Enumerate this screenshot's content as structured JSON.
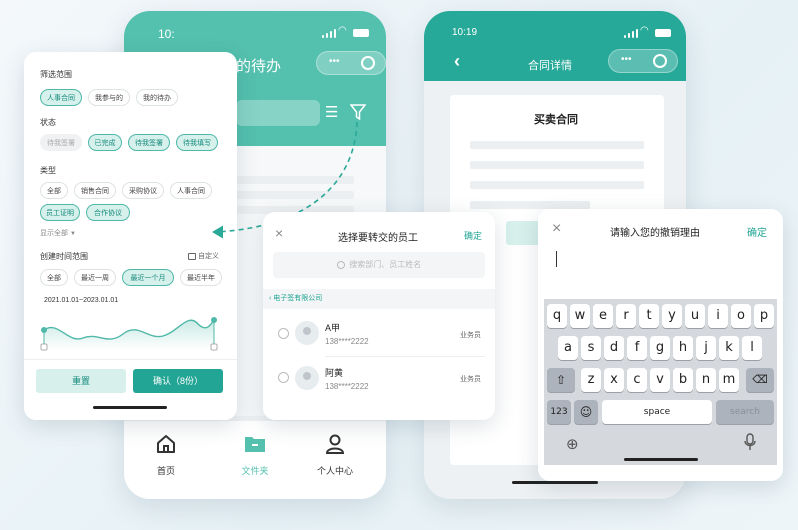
{
  "phone1": {
    "time": "10:",
    "title": "的待办",
    "nav": [
      {
        "label": "首页",
        "icon": "home-icon"
      },
      {
        "label": "文件夹",
        "icon": "folder-icon"
      },
      {
        "label": "个人中心",
        "icon": "person-icon"
      }
    ],
    "accent": "#54c0ae"
  },
  "phone2": {
    "time": "10:19",
    "title": "合同详情",
    "doc_title": "买卖合同",
    "header_color": "#26a998"
  },
  "filter": {
    "scope_label": "筛选范围",
    "scope_chips": [
      {
        "label": "人事合同",
        "selected": true
      },
      {
        "label": "我参与的",
        "selected": false
      },
      {
        "label": "我的待办",
        "selected": false
      }
    ],
    "status_label": "状态",
    "status_chips": [
      {
        "label": "待我签署",
        "state": "disabled"
      },
      {
        "label": "已完成",
        "state": "selected"
      },
      {
        "label": "待我签署",
        "state": "selected"
      },
      {
        "label": "待我填写",
        "state": "selected"
      }
    ],
    "type_label": "类型",
    "type_chips": [
      {
        "label": "全部",
        "selected": false
      },
      {
        "label": "销售合同",
        "selected": false
      },
      {
        "label": "采购协议",
        "selected": false
      },
      {
        "label": "人事合同",
        "selected": false
      },
      {
        "label": "员工证明",
        "selected": true
      },
      {
        "label": "合作协议",
        "selected": true
      }
    ],
    "show_all": "显示全部",
    "date_label": "创建时间范围",
    "custom_label": "自定义",
    "date_chips": [
      {
        "label": "全部",
        "selected": false
      },
      {
        "label": "最近一周",
        "selected": false
      },
      {
        "label": "最近一个月",
        "selected": true
      },
      {
        "label": "最近半年",
        "selected": false
      }
    ],
    "date_range": "2021.01.01~2023.01.01",
    "reset_label": "重置",
    "confirm_label": "确认（8份）"
  },
  "transfer": {
    "title": "选择要转交的员工",
    "confirm": "确定",
    "search_placeholder": "搜索部门、员工姓名",
    "company": "电子签有限公司",
    "employees": [
      {
        "name": "A甲",
        "phone": "138****2222",
        "role": "业务员"
      },
      {
        "name": "阿黄",
        "phone": "138****2222",
        "role": "业务员"
      }
    ]
  },
  "revoke": {
    "title": "请输入您的撤销理由",
    "confirm": "确定",
    "keyboard": {
      "row1": [
        "q",
        "w",
        "e",
        "r",
        "t",
        "y",
        "u",
        "i",
        "o",
        "p"
      ],
      "row2": [
        "a",
        "s",
        "d",
        "f",
        "g",
        "h",
        "j",
        "k",
        "l"
      ],
      "row3": [
        "z",
        "x",
        "c",
        "v",
        "b",
        "n",
        "m"
      ],
      "num_key": "123",
      "space_key": "space",
      "search_key": "search"
    }
  }
}
